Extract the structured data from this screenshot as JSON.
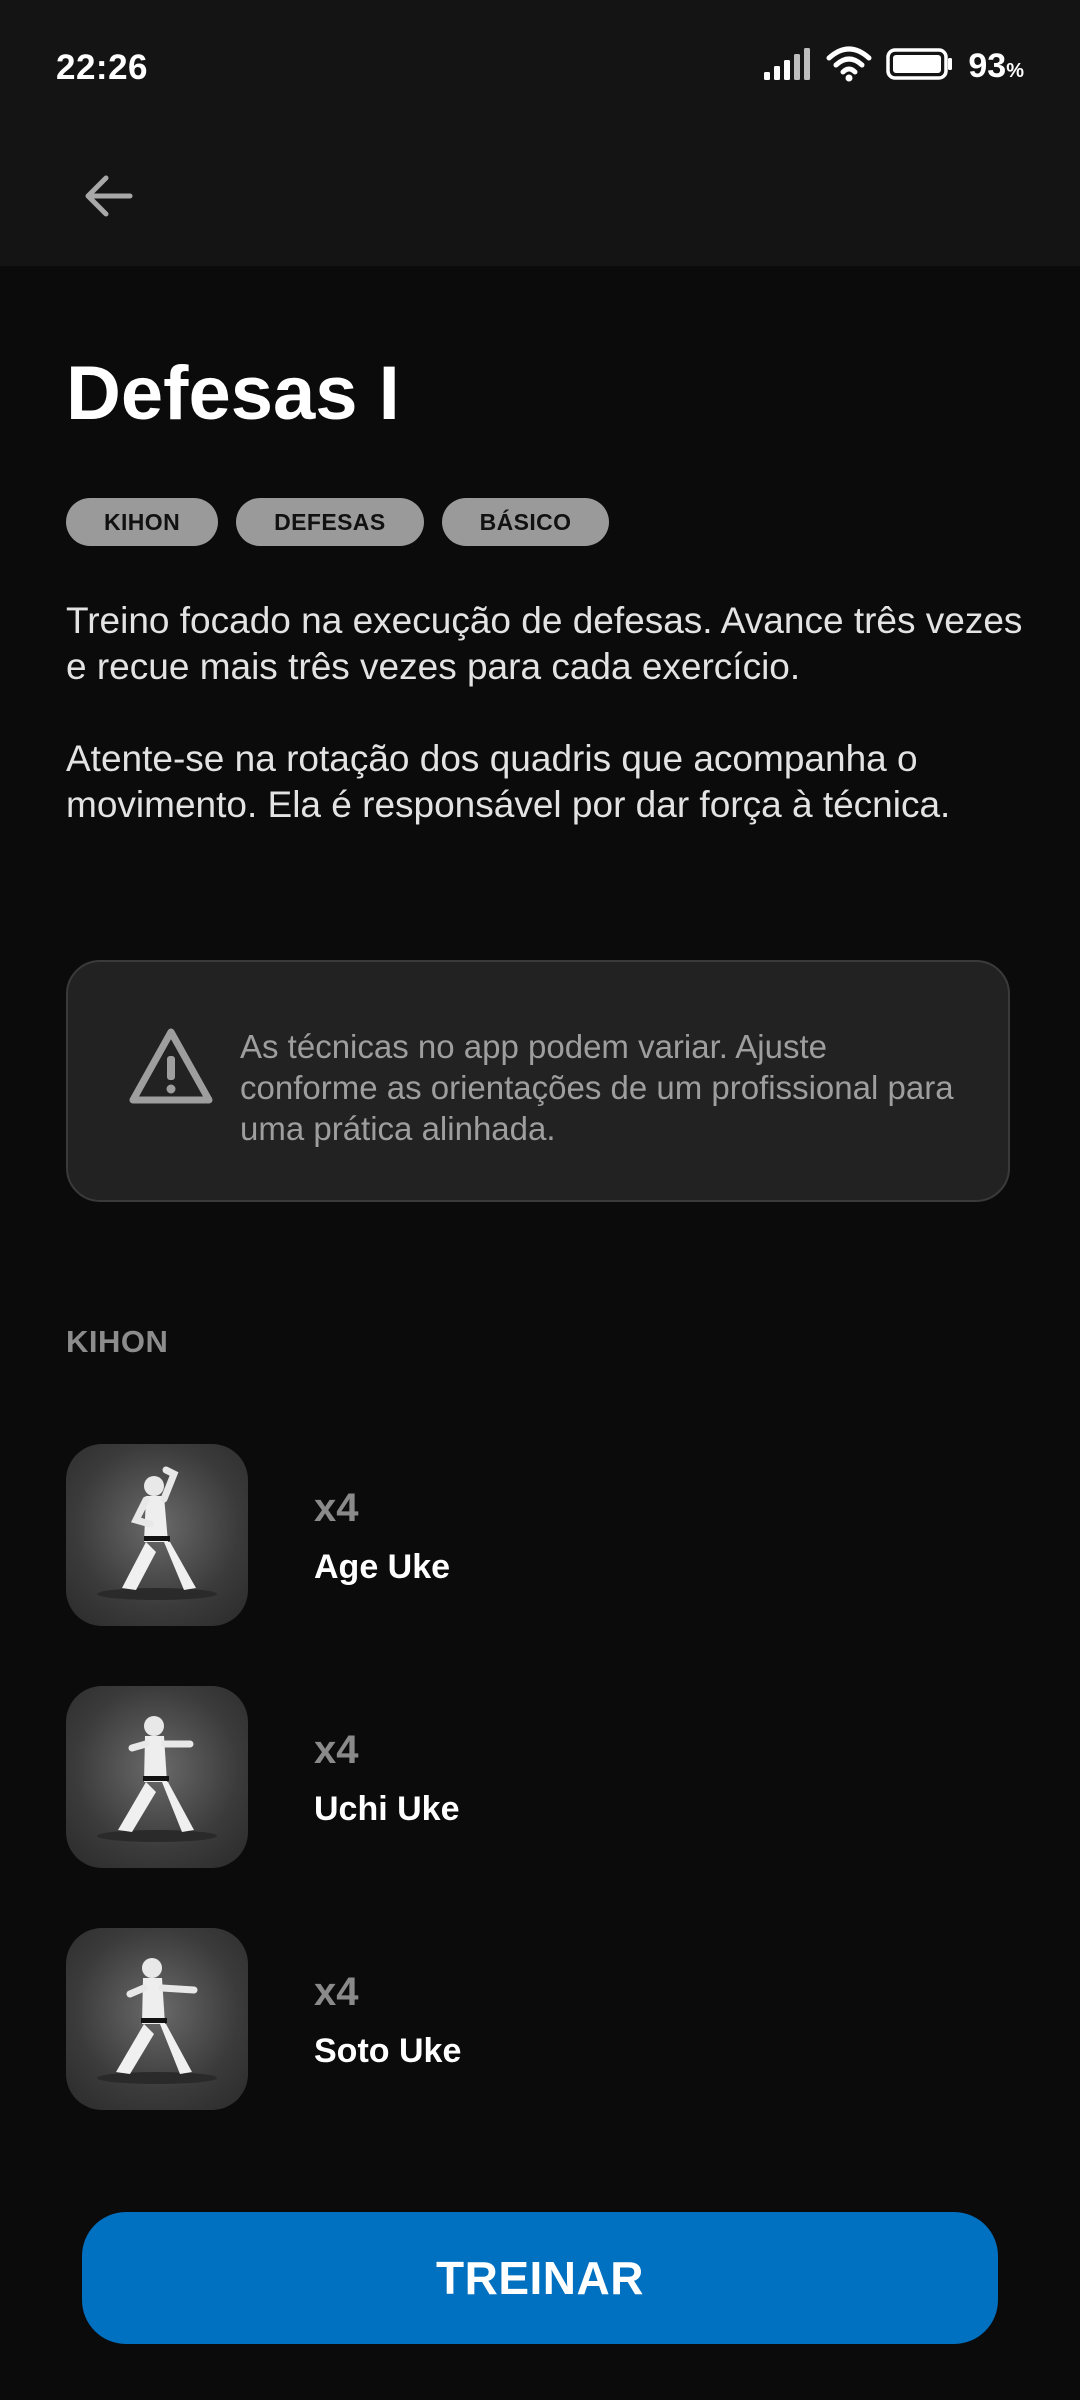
{
  "status_bar": {
    "time": "22:26",
    "battery_percent": "93",
    "battery_unit": "%",
    "icons": [
      "signal-icon",
      "wifi-icon",
      "battery-icon"
    ]
  },
  "app_bar": {
    "back_icon": "arrow-left-icon"
  },
  "page": {
    "title": "Defesas I",
    "tags": [
      "KIHON",
      "DEFESAS",
      "BÁSICO"
    ],
    "description": [
      "Treino focado na execução de defesas. Avance três vezes e recue mais três vezes para cada exercício.",
      "Atente-se na rotação dos quadris que acompanha o movimento. Ela é responsável por dar força à técnica."
    ],
    "warning": {
      "icon": "warning-triangle-icon",
      "text": "As técnicas no app podem variar. Ajuste conforme as orientações de um profissional para uma prática alinhada."
    }
  },
  "section": {
    "label": "KIHON",
    "exercises": [
      {
        "reps": "x4",
        "name": "Age Uke"
      },
      {
        "reps": "x4",
        "name": "Uchi Uke"
      },
      {
        "reps": "x4",
        "name": "Soto Uke"
      }
    ]
  },
  "actions": {
    "train_label": "TREINAR"
  },
  "colors": {
    "background": "#0b0b0c",
    "surface": "#141414",
    "card": "#222222",
    "tag": "#9a9a9a",
    "accent": "#0070c0"
  }
}
